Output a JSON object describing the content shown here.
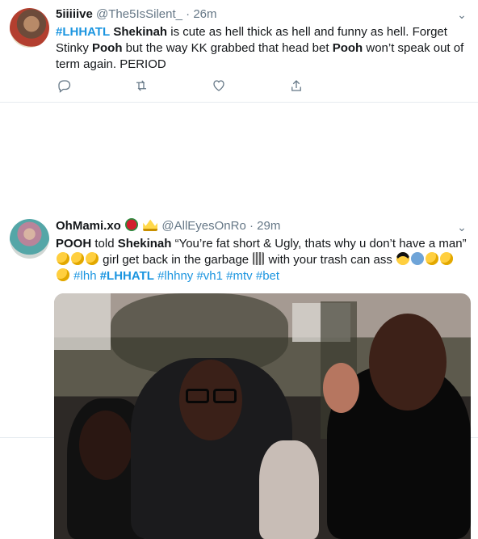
{
  "tweets": [
    {
      "name": "5iiiiive",
      "handle": "@The5IsSilent_",
      "time": "26m",
      "text_parts": [
        "#LHHATL",
        " ",
        "Shekinah",
        " is cute as hell thick as hell and funny as hell. Forget Stinky ",
        "Pooh",
        " but the way KK grabbed that head bet ",
        "Pooh",
        " won’t speak out of term again. PERIOD"
      ],
      "actions": [
        "reply-icon",
        "retweet-icon",
        "like-icon",
        "share-icon"
      ]
    },
    {
      "name": "OhMami.xo",
      "handle": "@AllEyesOnRo",
      "time": "29m",
      "text_parts": [
        "POOH",
        " told ",
        "Shekinah",
        " “You’re fat short & Ugly, thats why u don’t have a man” ",
        " girl get back in the garbage ",
        " with your trash can ass ",
        "#lhh",
        " ",
        "#LHHATL",
        " ",
        "#lhhny",
        " ",
        "#vh1",
        " ",
        "#mtv",
        " ",
        "#bet"
      ],
      "media_label": "video-thumbnail"
    }
  ],
  "colors": {
    "text": "#14171a",
    "secondary": "#657786",
    "link": "#1b95e0",
    "border": "#e6ecf0"
  }
}
